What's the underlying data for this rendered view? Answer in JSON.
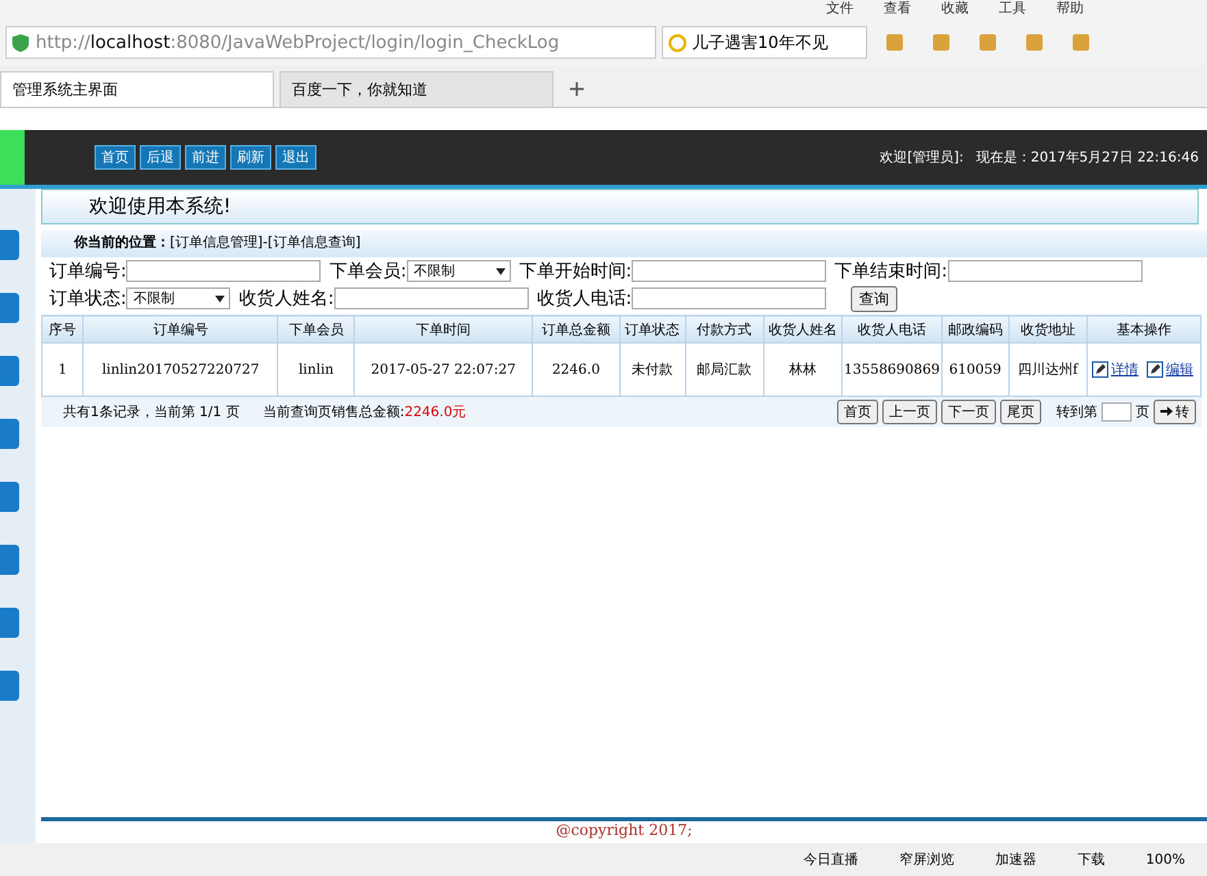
{
  "browser": {
    "menu": [
      "文件",
      "查看",
      "收藏",
      "工具",
      "帮助"
    ],
    "url": {
      "prefix": "http://",
      "host": "localhost",
      "rest": ":8080/JavaWebProject/login/login_CheckLog"
    },
    "search_value": "儿子遇害10年不见",
    "tabs": [
      {
        "label": "管理系统主界面",
        "selected": true
      },
      {
        "label": "百度一下，你就知道",
        "selected": false
      }
    ],
    "status_items": [
      "今日直播",
      "窄屏浏览",
      "加速器",
      "下载"
    ],
    "zoom": "100%"
  },
  "header": {
    "nav_buttons": [
      "首页",
      "后退",
      "前进",
      "刷新",
      "退出"
    ],
    "welcome": "欢迎[管理员]:",
    "time": "现在是：2017年5月27日 22:16:46"
  },
  "welcome_bar": "欢迎使用本系统!",
  "location": {
    "label": "你当前的位置：",
    "path": "[订单信息管理]-[订单信息查询]"
  },
  "filters": [
    [
      {
        "label": "订单编号:",
        "kind": "input"
      },
      {
        "label": "下单会员:",
        "kind": "select",
        "value": "不限制"
      },
      {
        "label": "下单开始时间:",
        "kind": "input"
      },
      {
        "label": "下单结束时间:",
        "kind": "input"
      }
    ],
    [
      {
        "label": "订单状态:",
        "kind": "select",
        "value": "不限制"
      },
      {
        "label": "收货人姓名:",
        "kind": "input"
      },
      {
        "label": "收货人电话:",
        "kind": "input"
      },
      {
        "label": "查询",
        "kind": "button"
      }
    ]
  ],
  "table": {
    "columns": [
      "序号",
      "订单编号",
      "下单会员",
      "下单时间",
      "订单总金额",
      "订单状态",
      "付款方式",
      "收货人姓名",
      "收货人电话",
      "邮政编码",
      "收货地址",
      "基本操作"
    ],
    "rows": [
      {
        "cells": [
          "1",
          "linlin20170527220727",
          "linlin",
          "2017-05-27 22:07:27",
          "2246.0",
          "未付款",
          "邮局汇款",
          "林林",
          "13558690869",
          "610059",
          "四川达州f"
        ],
        "actions": [
          "详情",
          "编辑"
        ]
      }
    ]
  },
  "footer": {
    "summary": "共有1条记录，当前第 1/1 页",
    "total_label": "当前查询页销售总金额:",
    "total": "2246.0元",
    "pager": [
      "首页",
      "上一页",
      "下一页",
      "尾页"
    ],
    "goto": "转到第",
    "page_unit": "页",
    "go": "转"
  },
  "copyright": "@copyright 2017;"
}
